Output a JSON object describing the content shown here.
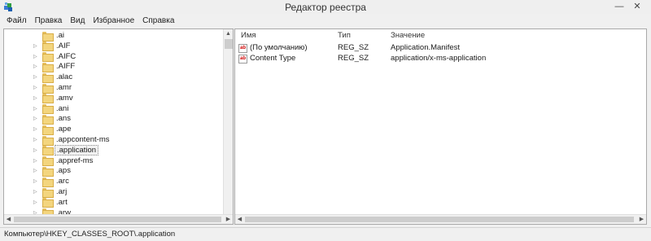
{
  "window": {
    "title": "Редактор реестра",
    "minimize": "—",
    "close": "✕"
  },
  "menu": [
    "Файл",
    "Правка",
    "Вид",
    "Избранное",
    "Справка"
  ],
  "tree": {
    "nodes": [
      {
        "label": ".ai"
      },
      {
        "label": ".AIF"
      },
      {
        "label": ".AIFC"
      },
      {
        "label": ".AIFF"
      },
      {
        "label": ".alac"
      },
      {
        "label": ".amr"
      },
      {
        "label": ".amv"
      },
      {
        "label": ".ani"
      },
      {
        "label": ".ans"
      },
      {
        "label": ".ape"
      },
      {
        "label": ".appcontent-ms"
      },
      {
        "label": ".application",
        "selected": true
      },
      {
        "label": ".appref-ms"
      },
      {
        "label": ".aps"
      },
      {
        "label": ".arc"
      },
      {
        "label": ".arj"
      },
      {
        "label": ".art"
      },
      {
        "label": ".arw"
      }
    ]
  },
  "values": {
    "columns": {
      "name": "Имя",
      "type": "Тип",
      "value": "Значение"
    },
    "rows": [
      {
        "name": "(По умолчанию)",
        "type": "REG_SZ",
        "value": "Application.Manifest"
      },
      {
        "name": "Content Type",
        "type": "REG_SZ",
        "value": "application/x-ms-application"
      }
    ]
  },
  "status": {
    "path": "Компьютер\\HKEY_CLASSES_ROOT\\.application"
  },
  "icons": {
    "app": "regedit-icon",
    "folder": "folder-icon",
    "string_value": "string-value-icon"
  },
  "colors": {
    "folder": "#f3d57e",
    "window_bg": "#f0f0f0",
    "pane_bg": "#ffffff"
  }
}
